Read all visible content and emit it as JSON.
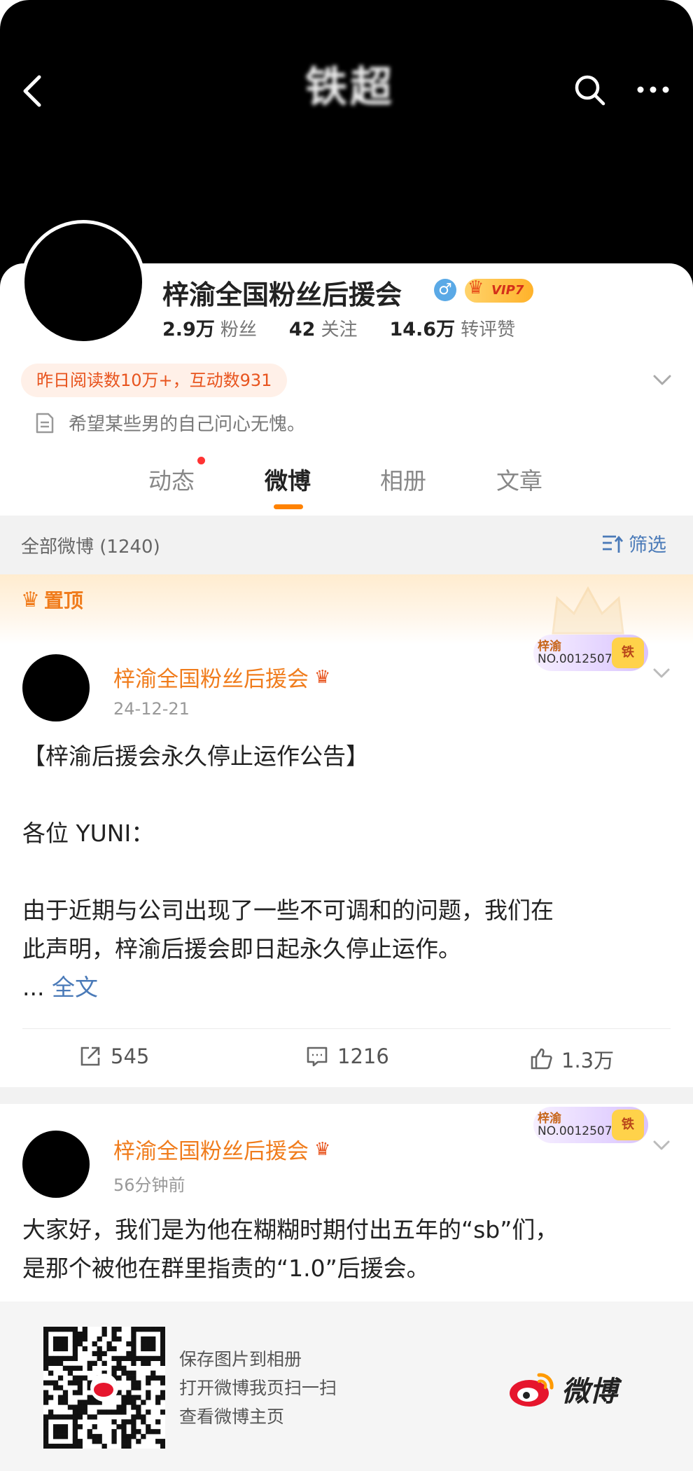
{
  "header": {
    "title": "铁超",
    "back_icon": "chevron-left-icon",
    "search_icon": "search-icon",
    "more_icon": "more-dots-icon"
  },
  "profile": {
    "name": "梓渝全国粉丝后援会",
    "gender_icon": "♂",
    "vip_label": "VIP7",
    "stats": [
      {
        "value": "2.9万",
        "label": "粉丝"
      },
      {
        "value": "42",
        "label": "关注"
      },
      {
        "value": "14.6万",
        "label": "转评赞"
      }
    ],
    "read_stat": "昨日阅读数10万+，互动数931",
    "bio": "希望某些男的自己问心无愧。"
  },
  "tabs": [
    {
      "label": "动态",
      "active": false,
      "has_dot": true
    },
    {
      "label": "微博",
      "active": true,
      "has_dot": false
    },
    {
      "label": "相册",
      "active": false,
      "has_dot": false
    },
    {
      "label": "文章",
      "active": false,
      "has_dot": false
    }
  ],
  "filter": {
    "count_label": "全部微博 (1240)",
    "filter_label": "筛选"
  },
  "pinned": {
    "label": "置顶"
  },
  "posts": [
    {
      "author": "梓渝全国粉丝后援会",
      "time": "24-12-21",
      "fan_badge": {
        "name": "梓渝",
        "number": "NO.0012507",
        "mark": "铁"
      },
      "lines": [
        "【梓渝后援会永久停止运作公告】",
        "",
        "各位 YUNI：",
        "",
        "由于近期与公司出现了一些不可调和的问题，我们在",
        "此声明，梓渝后援会即日起永久停止运作。"
      ],
      "ellipsis": "...",
      "more_label": "全文",
      "actions": {
        "repost": "545",
        "comment": "1216",
        "like": "1.3万"
      }
    },
    {
      "author": "梓渝全国粉丝后援会",
      "time": "56分钟前",
      "fan_badge": {
        "name": "梓渝",
        "number": "NO.0012507",
        "mark": "铁"
      },
      "lines": [
        "大家好，我们是为他在糊糊时期付出五年的“sb”们，",
        "是那个被他在群里指责的“1.0”后援会。"
      ]
    }
  ],
  "footer": {
    "lines": [
      "保存图片到相册",
      "打开微博我页扫一扫",
      "查看微博主页"
    ],
    "logo_text": "微博"
  },
  "colors": {
    "accent": "#ff8200",
    "name_orange": "#f07c1c",
    "link_blue": "#4a7ab8"
  }
}
